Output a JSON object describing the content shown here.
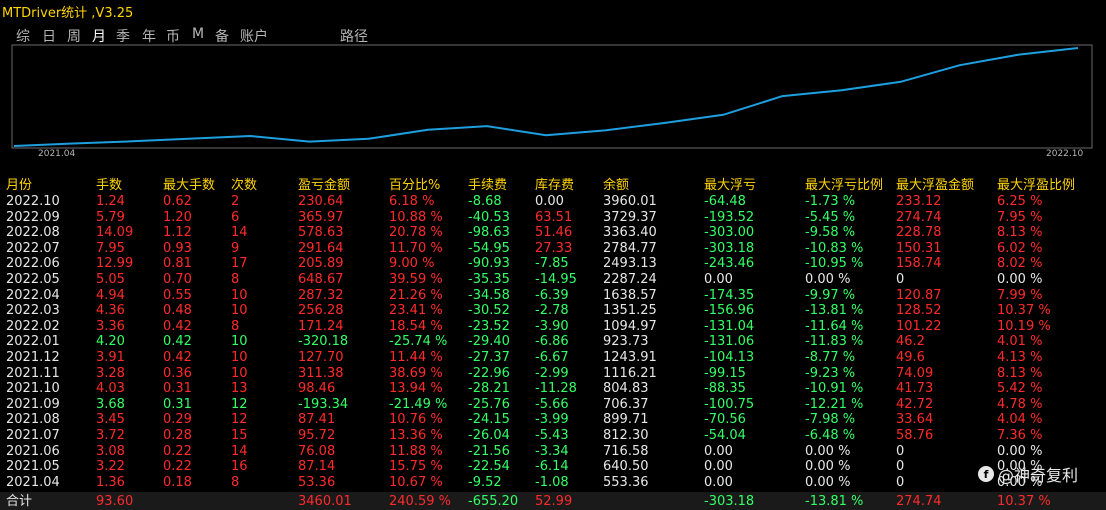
{
  "window": {
    "title": "MTDriver统计 ,V3.25"
  },
  "tabs": [
    "综",
    "日",
    "周",
    "月",
    "季",
    "年",
    "币",
    "M",
    "备",
    "账户",
    "路径"
  ],
  "active_tab": "月",
  "chart": {
    "start_label": "2021.04",
    "end_label": "2022.10",
    "line_color": "#1e9fe0"
  },
  "chart_data": {
    "type": "line",
    "x": [
      "2021.04",
      "2021.05",
      "2021.06",
      "2021.07",
      "2021.08",
      "2021.09",
      "2021.10",
      "2021.11",
      "2021.12",
      "2022.01",
      "2022.02",
      "2022.03",
      "2022.04",
      "2022.05",
      "2022.06",
      "2022.07",
      "2022.08",
      "2022.09",
      "2022.10"
    ],
    "values": [
      553.36,
      640.5,
      716.58,
      812.3,
      899.71,
      706.37,
      804.83,
      1116.21,
      1243.91,
      923.73,
      1094.97,
      1351.25,
      1638.57,
      2287.24,
      2493.13,
      2784.77,
      3363.4,
      3729.37,
      3960.01
    ],
    "xlabels": [
      "2021.04",
      "2022.10"
    ]
  },
  "table": {
    "headers": [
      "月份",
      "手数",
      "最大手数",
      "次数",
      "盈亏金额",
      "百分比%",
      "手续费",
      "库存费",
      "余额",
      "最大浮亏",
      "最大浮亏比例",
      "最大浮盈金额",
      "最大浮盈比例"
    ],
    "rows": [
      [
        "2022.10",
        "1.24",
        "0.62",
        "2",
        "230.64",
        "6.18 %",
        "-8.68",
        "0.00",
        "3960.01",
        "-64.48",
        "-1.73 %",
        "233.12",
        "6.25 %"
      ],
      [
        "2022.09",
        "5.79",
        "1.20",
        "6",
        "365.97",
        "10.88 %",
        "-40.53",
        "63.51",
        "3729.37",
        "-193.52",
        "-5.45 %",
        "274.74",
        "7.95 %"
      ],
      [
        "2022.08",
        "14.09",
        "1.12",
        "14",
        "578.63",
        "20.78 %",
        "-98.63",
        "51.46",
        "3363.40",
        "-303.00",
        "-9.58 %",
        "228.78",
        "8.13 %"
      ],
      [
        "2022.07",
        "7.95",
        "0.93",
        "9",
        "291.64",
        "11.70 %",
        "-54.95",
        "27.33",
        "2784.77",
        "-303.18",
        "-10.83 %",
        "150.31",
        "6.02 %"
      ],
      [
        "2022.06",
        "12.99",
        "0.81",
        "17",
        "205.89",
        "9.00 %",
        "-90.93",
        "-7.85",
        "2493.13",
        "-243.46",
        "-10.95 %",
        "158.74",
        "8.02 %"
      ],
      [
        "2022.05",
        "5.05",
        "0.70",
        "8",
        "648.67",
        "39.59 %",
        "-35.35",
        "-14.95",
        "2287.24",
        "0.00",
        "0.00 %",
        "0",
        "0.00 %"
      ],
      [
        "2022.04",
        "4.94",
        "0.55",
        "10",
        "287.32",
        "21.26 %",
        "-34.58",
        "-6.39",
        "1638.57",
        "-174.35",
        "-9.97 %",
        "120.87",
        "7.99 %"
      ],
      [
        "2022.03",
        "4.36",
        "0.48",
        "10",
        "256.28",
        "23.41 %",
        "-30.52",
        "-2.78",
        "1351.25",
        "-156.96",
        "-13.81 %",
        "128.52",
        "10.37 %"
      ],
      [
        "2022.02",
        "3.36",
        "0.42",
        "8",
        "171.24",
        "18.54 %",
        "-23.52",
        "-3.90",
        "1094.97",
        "-131.04",
        "-11.64 %",
        "101.22",
        "10.19 %"
      ],
      [
        "2022.01",
        "4.20",
        "0.42",
        "10",
        "-320.18",
        "-25.74 %",
        "-29.40",
        "-6.86",
        "923.73",
        "-131.06",
        "-11.83 %",
        "46.2",
        "4.01 %"
      ],
      [
        "2021.12",
        "3.91",
        "0.42",
        "10",
        "127.70",
        "11.44 %",
        "-27.37",
        "-6.67",
        "1243.91",
        "-104.13",
        "-8.77 %",
        "49.6",
        "4.13 %"
      ],
      [
        "2021.11",
        "3.28",
        "0.36",
        "10",
        "311.38",
        "38.69 %",
        "-22.96",
        "-2.99",
        "1116.21",
        "-99.15",
        "-9.23 %",
        "74.09",
        "8.13 %"
      ],
      [
        "2021.10",
        "4.03",
        "0.31",
        "13",
        "98.46",
        "13.94 %",
        "-28.21",
        "-11.28",
        "804.83",
        "-88.35",
        "-10.91 %",
        "41.73",
        "5.42 %"
      ],
      [
        "2021.09",
        "3.68",
        "0.31",
        "12",
        "-193.34",
        "-21.49 %",
        "-25.76",
        "-5.66",
        "706.37",
        "-100.75",
        "-12.21 %",
        "42.72",
        "4.78 %"
      ],
      [
        "2021.08",
        "3.45",
        "0.29",
        "12",
        "87.41",
        "10.76 %",
        "-24.15",
        "-3.99",
        "899.71",
        "-70.56",
        "-7.98 %",
        "33.64",
        "4.04 %"
      ],
      [
        "2021.07",
        "3.72",
        "0.28",
        "15",
        "95.72",
        "13.36 %",
        "-26.04",
        "-5.43",
        "812.30",
        "-54.04",
        "-6.48 %",
        "58.76",
        "7.36 %"
      ],
      [
        "2021.06",
        "3.08",
        "0.22",
        "14",
        "76.08",
        "11.88 %",
        "-21.56",
        "-3.34",
        "716.58",
        "0.00",
        "0.00 %",
        "0",
        "0.00 %"
      ],
      [
        "2021.05",
        "3.22",
        "0.22",
        "16",
        "87.14",
        "15.75 %",
        "-22.54",
        "-6.14",
        "640.50",
        "0.00",
        "0.00 %",
        "0",
        "0.00 %"
      ],
      [
        "2021.04",
        "1.36",
        "0.18",
        "8",
        "53.36",
        "10.67 %",
        "-9.52",
        "-1.08",
        "553.36",
        "0.00",
        "0.00 %",
        "0",
        "0.00 %"
      ]
    ],
    "total": [
      "合计",
      "93.60",
      "",
      "",
      "3460.01",
      "240.59 %",
      "-655.20",
      "52.99",
      "",
      "-303.18",
      "-13.81 %",
      "274.74",
      "10.37 %"
    ]
  },
  "watermark": {
    "icon": "f",
    "text": "@神奇复利"
  },
  "colors": {
    "header": "#ffd400",
    "positive": "#ff2a2a",
    "negative": "#33ff66",
    "neutral": "#e6e6e6",
    "line": "#1e9fe0"
  }
}
